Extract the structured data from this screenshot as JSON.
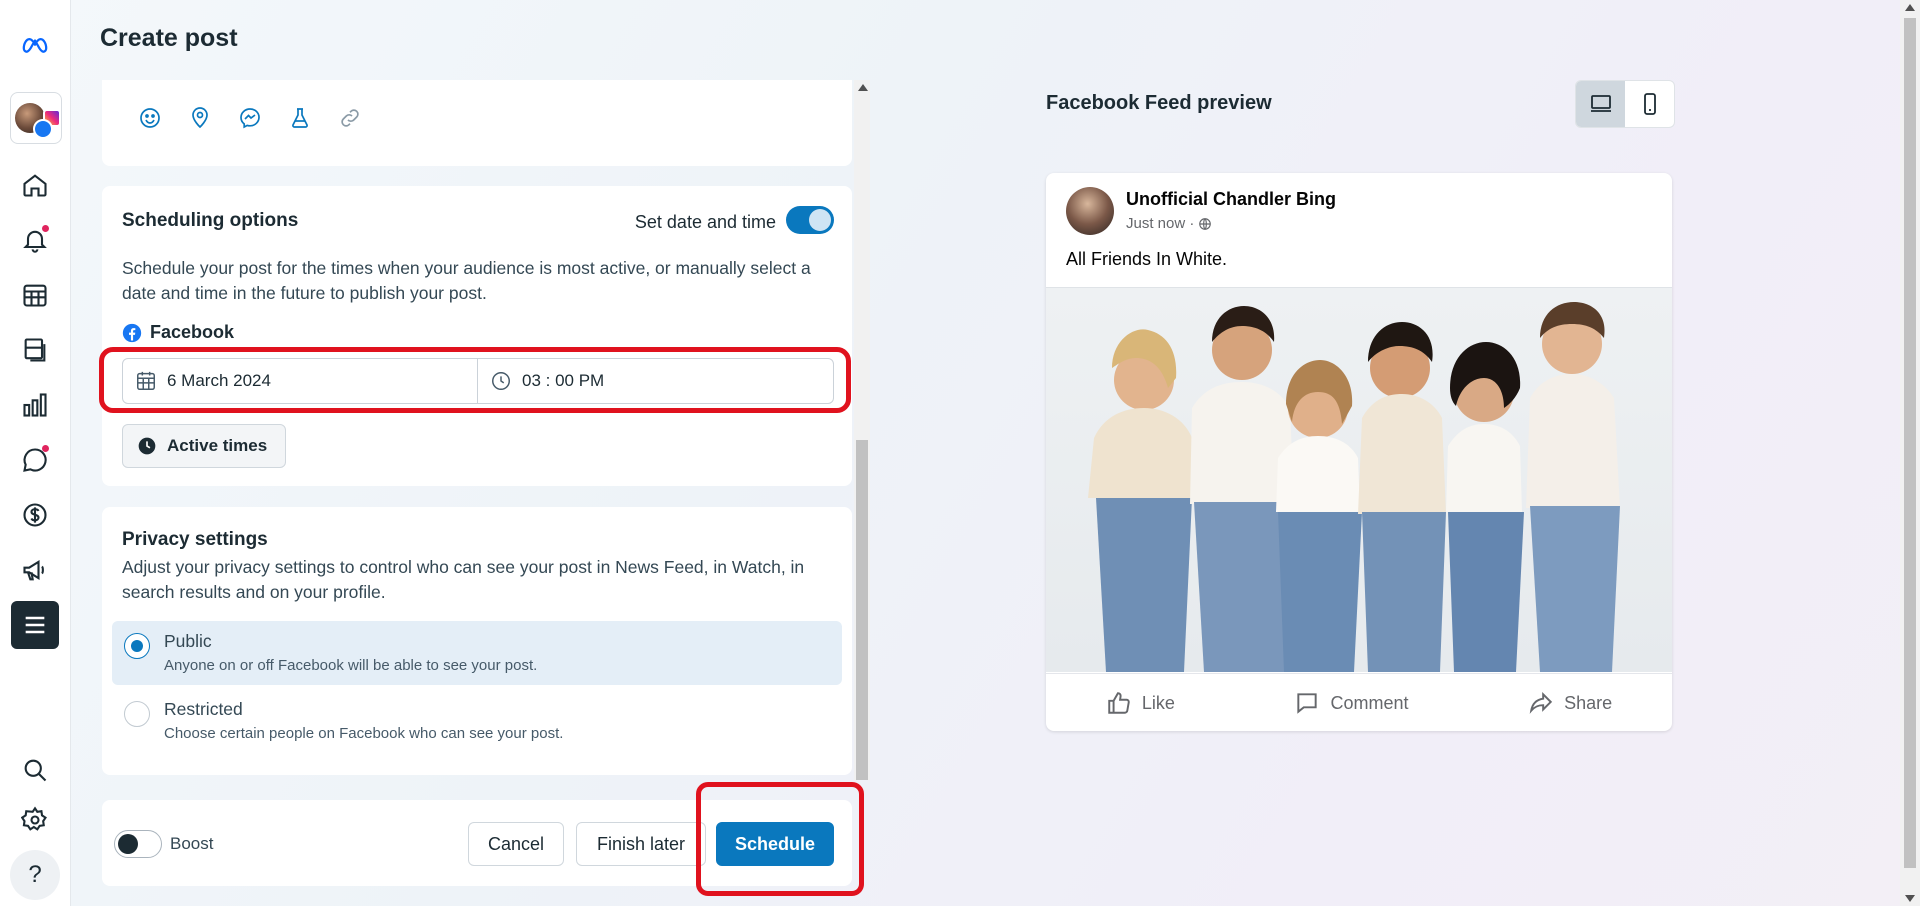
{
  "app": {
    "title": "Create post"
  },
  "colors": {
    "accent": "#0a78be",
    "highlight": "#e0121e",
    "sidebar_dark": "#1c2b33"
  },
  "sidebar": {
    "items": [
      {
        "icon": "meta-logo-icon"
      },
      {
        "icon": "account-avatar"
      },
      {
        "icon": "home-icon"
      },
      {
        "icon": "notifications-icon",
        "badge": true
      },
      {
        "icon": "content-calendar-icon"
      },
      {
        "icon": "posts-icon"
      },
      {
        "icon": "insights-icon"
      },
      {
        "icon": "inbox-icon",
        "badge": true
      },
      {
        "icon": "monetization-icon"
      },
      {
        "icon": "ads-icon"
      },
      {
        "icon": "all-tools-menu-icon"
      },
      {
        "icon": "search-icon"
      },
      {
        "icon": "settings-icon"
      },
      {
        "icon": "help-icon"
      }
    ],
    "help_label": "?"
  },
  "composer": {
    "tool_icons": [
      "emoji-icon",
      "location-icon",
      "messenger-icon",
      "flask-icon",
      "link-icon"
    ]
  },
  "scheduling": {
    "title": "Scheduling options",
    "toggle_label": "Set date and time",
    "toggle_on": true,
    "description": "Schedule your post for the times when your audience is most active, or manually select a date and time in the future to publish your post.",
    "platform": "Facebook",
    "date": "6 March 2024",
    "time": "03 : 00 PM",
    "active_times_label": "Active times"
  },
  "privacy": {
    "title": "Privacy settings",
    "description": "Adjust your privacy settings to control who can see your post in News Feed, in Watch, in search results and on your profile.",
    "options": [
      {
        "label": "Public",
        "sub": "Anyone on or off Facebook will be able to see your post.",
        "selected": true
      },
      {
        "label": "Restricted",
        "sub": "Choose certain people on Facebook who can see your post.",
        "selected": false
      }
    ]
  },
  "footer": {
    "boost_label": "Boost",
    "boost_on": false,
    "cancel_label": "Cancel",
    "finish_later_label": "Finish later",
    "schedule_label": "Schedule"
  },
  "preview": {
    "title": "Facebook Feed preview",
    "views": [
      "desktop-icon",
      "mobile-icon"
    ],
    "selected_view": "desktop",
    "post": {
      "author": "Unofficial Chandler Bing",
      "time": "Just now ·",
      "text": "All Friends In White.",
      "actions": [
        "Like",
        "Comment",
        "Share"
      ]
    }
  }
}
